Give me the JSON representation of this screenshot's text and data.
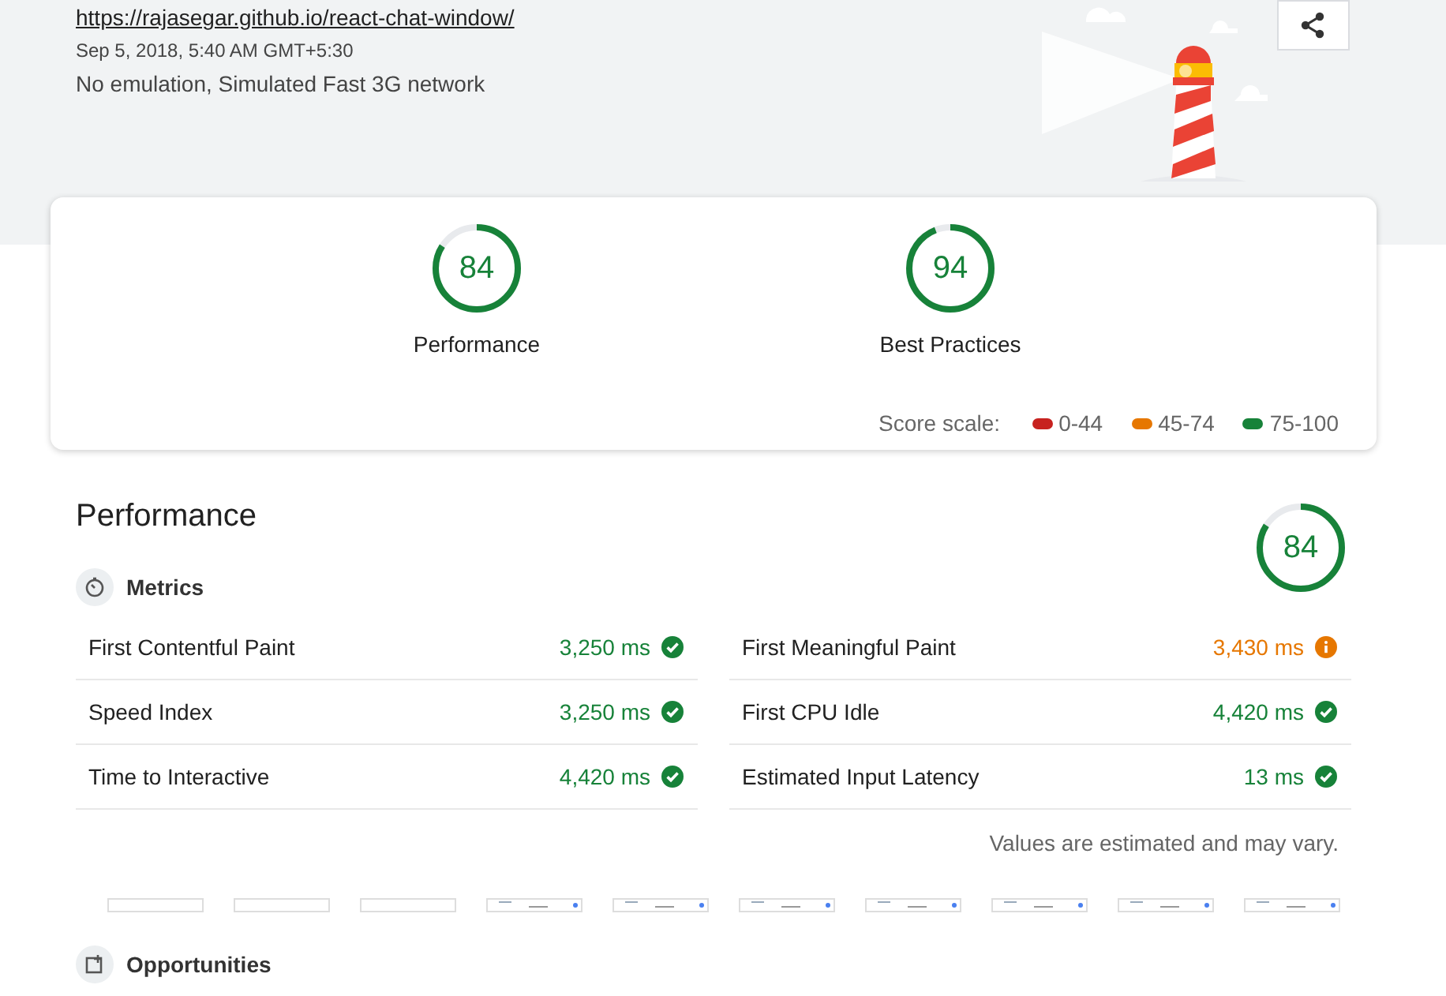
{
  "header": {
    "url": "https://rajasegar.github.io/react-chat-window/",
    "date": "Sep 5, 2018, 5:40 AM GMT+5:30",
    "environment": "No emulation, Simulated Fast 3G network"
  },
  "gauges": [
    {
      "score": "84",
      "level": 0.84,
      "label": "Performance"
    },
    {
      "score": "94",
      "level": 0.94,
      "label": "Best Practices"
    }
  ],
  "score_scale": {
    "label": "Score scale:",
    "ranges": [
      {
        "text": "0-44",
        "color": "#c7221f"
      },
      {
        "text": "45-74",
        "color": "#e67700"
      },
      {
        "text": "75-100",
        "color": "#178239"
      }
    ]
  },
  "performance": {
    "title": "Performance",
    "score": "84",
    "level": 0.84,
    "metrics_title": "Metrics",
    "metrics": [
      {
        "name": "First Contentful Paint",
        "value": "3,250 ms",
        "kind": "pass"
      },
      {
        "name": "First Meaningful Paint",
        "value": "3,430 ms",
        "kind": "average"
      },
      {
        "name": "Speed Index",
        "value": "3,250 ms",
        "kind": "pass"
      },
      {
        "name": "First CPU Idle",
        "value": "4,420 ms",
        "kind": "pass"
      },
      {
        "name": "Time to Interactive",
        "value": "4,420 ms",
        "kind": "pass"
      },
      {
        "name": "Estimated Input Latency",
        "value": "13 ms",
        "kind": "pass"
      }
    ],
    "note": "Values are estimated and may vary.",
    "filmstrip": [
      {
        "kind": "blank"
      },
      {
        "kind": "blank"
      },
      {
        "kind": "blank"
      },
      {
        "kind": "loaded"
      },
      {
        "kind": "loaded"
      },
      {
        "kind": "loaded"
      },
      {
        "kind": "loaded"
      },
      {
        "kind": "loaded"
      },
      {
        "kind": "loaded"
      },
      {
        "kind": "loaded"
      }
    ],
    "opportunities_title": "Opportunities"
  }
}
